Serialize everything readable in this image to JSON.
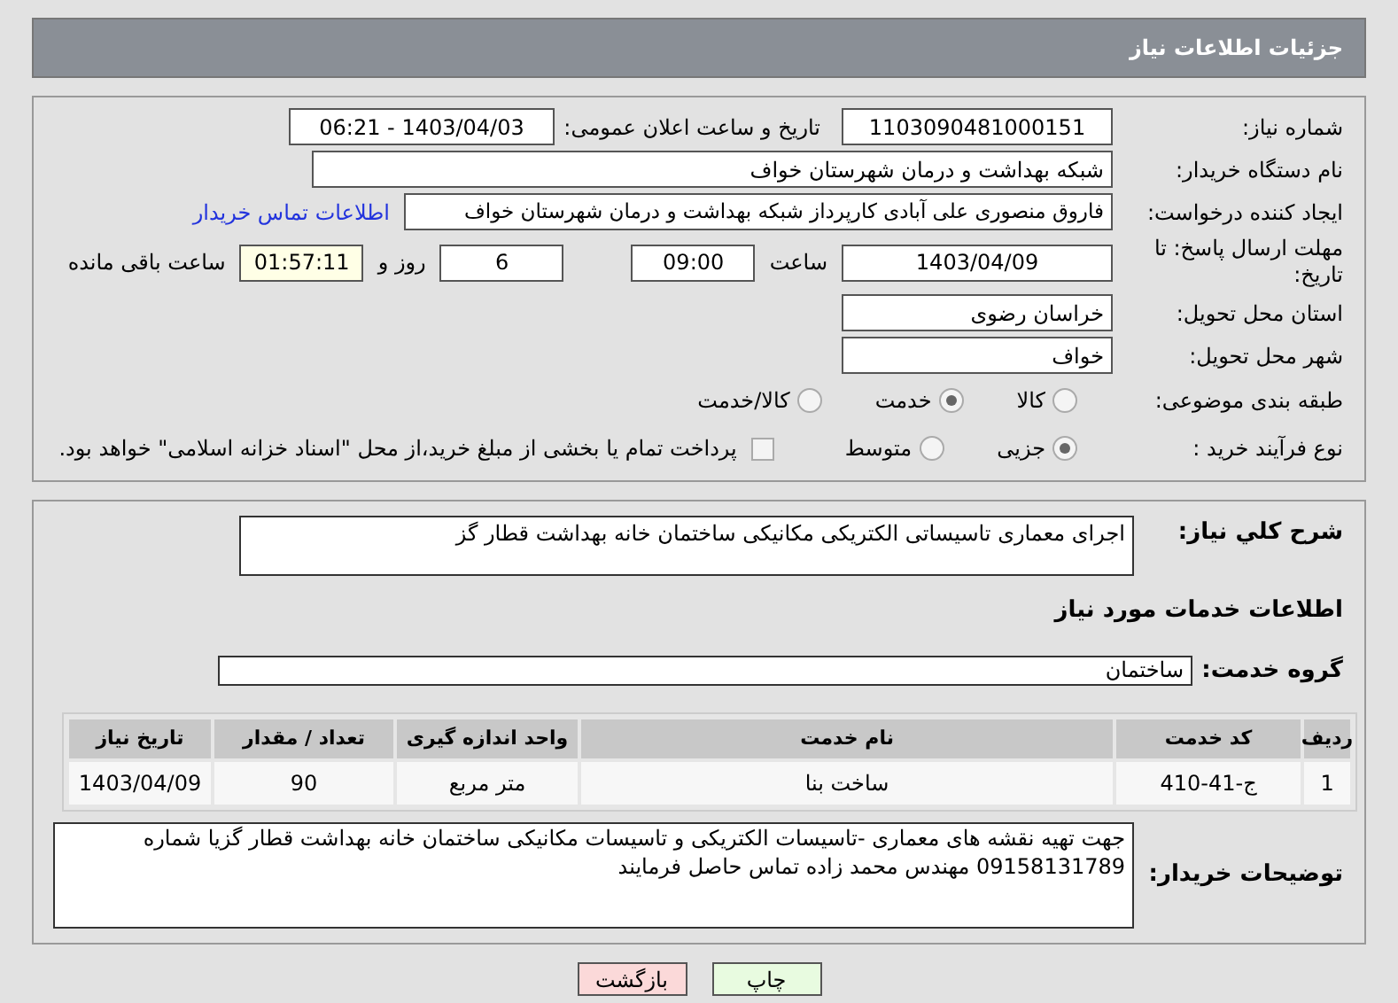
{
  "header": {
    "title": "جزئیات اطلاعات نیاز"
  },
  "need_number": {
    "label": "شماره نیاز:",
    "value": "1103090481000151"
  },
  "announce": {
    "label": "تاریخ و ساعت اعلان عمومی:",
    "value": "1403/04/03 - 06:21"
  },
  "buyer_org": {
    "label": "نام دستگاه خریدار:",
    "value": "شبکه بهداشت و درمان شهرستان خواف"
  },
  "requester": {
    "label": "ایجاد کننده درخواست:",
    "value": "فاروق منصوری علی آبادی کارپرداز شبکه بهداشت و درمان شهرستان خواف",
    "link": "اطلاعات تماس خریدار"
  },
  "deadline": {
    "label": "مهلت ارسال پاسخ: تا تاریخ:",
    "date": "1403/04/09",
    "time_label": "ساعت",
    "time": "09:00",
    "days": "6",
    "days_label": "روز و",
    "remaining": "01:57:11",
    "remaining_label": "ساعت باقی مانده"
  },
  "province": {
    "label": "استان محل تحویل:",
    "value": "خراسان رضوی"
  },
  "city": {
    "label": "شهر محل تحویل:",
    "value": "خواف"
  },
  "category": {
    "label": "طبقه بندی موضوعی:",
    "options": [
      {
        "label": "کالا",
        "selected": false
      },
      {
        "label": "خدمت",
        "selected": true
      },
      {
        "label": "کالا/خدمت",
        "selected": false
      }
    ]
  },
  "process": {
    "label": "نوع فرآیند خرید :",
    "options": [
      {
        "label": "جزیی",
        "selected": true
      },
      {
        "label": "متوسط",
        "selected": false
      }
    ],
    "payment": {
      "checked": false,
      "text": "پرداخت تمام یا بخشی از مبلغ خرید،از محل \"اسناد خزانه اسلامی\" خواهد بود."
    }
  },
  "summary": {
    "label": "شرح کلي نياز:",
    "value": "اجرای معماری تاسیساتی الکتریکی مکانیکی ساختمان خانه بهداشت قطار گز"
  },
  "services_heading": "اطلاعات خدمات مورد نیاز",
  "service_group": {
    "label": "گروه خدمت:",
    "value": "ساختمان"
  },
  "table": {
    "columns": [
      "ردیف",
      "کد خدمت",
      "نام خدمت",
      "واحد اندازه گیری",
      "تعداد / مقدار",
      "تاریخ نیاز"
    ],
    "rows": [
      [
        "1",
        "ج-41-410",
        "ساخت بنا",
        "متر مربع",
        "90",
        "1403/04/09"
      ]
    ]
  },
  "buyer_notes": {
    "label": "توضیحات خریدار:",
    "value": "جهت تهیه نقشه های معماری -تاسیسات الکتریکی و تاسیسات مکانیکی ساختمان خانه بهداشت قطار گزیا شماره 09158131789 مهندس محمد زاده تماس حاصل فرمایند"
  },
  "buttons": [
    {
      "label": "چاپ",
      "kind": "print"
    },
    {
      "label": "بازگشت",
      "kind": "back"
    }
  ]
}
